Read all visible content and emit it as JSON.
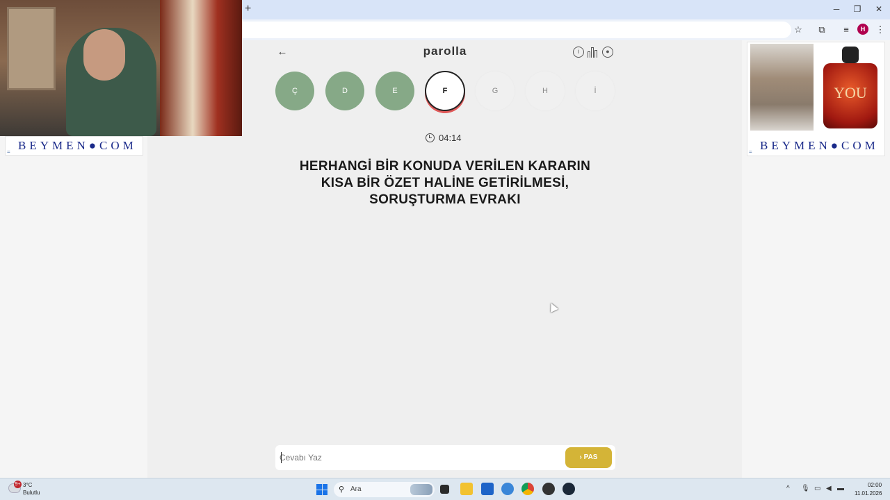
{
  "browser": {
    "new_tab_icon": "+",
    "window_controls": [
      "minimize-icon",
      "restore-icon",
      "close-icon"
    ],
    "toolbar_icons": [
      "star-icon",
      "extensions-icon",
      "media-icon",
      "profile-icon",
      "more-icon"
    ],
    "profile_initial": "H"
  },
  "ads": {
    "left_brand": "BEYMEN●COM",
    "right_brand": "BEYMEN●COM",
    "perfume_text": "YOU"
  },
  "game": {
    "title": "parolla",
    "header_icons": [
      "info-icon",
      "stats-icon",
      "user-icon"
    ],
    "letters": [
      {
        "label": "Ç",
        "state": "done"
      },
      {
        "label": "D",
        "state": "done"
      },
      {
        "label": "E",
        "state": "done"
      },
      {
        "label": "F",
        "state": "current"
      },
      {
        "label": "G",
        "state": "pending"
      },
      {
        "label": "H",
        "state": "pending"
      },
      {
        "label": "İ",
        "state": "pending"
      }
    ],
    "timer": "04:14",
    "question": "HERHANGİ BİR KONUDA VERİLEN KARARIN KISA BİR ÖZET HALİNE GETİRİLMESİ, SORUŞTURMA EVRAKI",
    "answer_placeholder": "Cevabı Yaz",
    "answer_value": "",
    "pass_label": "PAS"
  },
  "taskbar": {
    "weather_badge": "9+",
    "weather_temp": "3°C",
    "weather_desc": "Bulutlu",
    "search_placeholder": "Ara",
    "clock_time": "02:00",
    "clock_date": "11.01.2026"
  },
  "colors": {
    "done_letter": "#86a987",
    "pass_button": "#d4b437",
    "brand_blue": "#1a2a8a",
    "current_ring": "#e05a5a"
  }
}
